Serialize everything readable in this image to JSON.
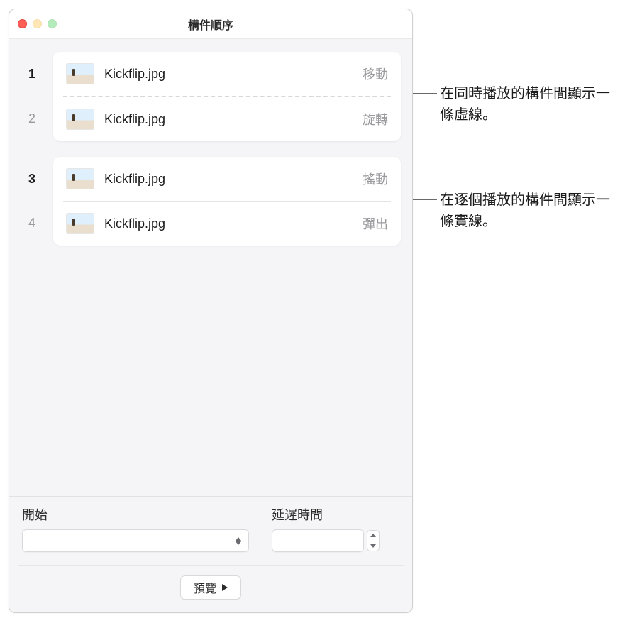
{
  "window": {
    "title": "構件順序"
  },
  "groups": [
    {
      "items": [
        {
          "number": "1",
          "dim": false,
          "filename": "Kickflip.jpg",
          "effect": "移動"
        },
        {
          "number": "2",
          "dim": true,
          "filename": "Kickflip.jpg",
          "effect": "旋轉"
        }
      ],
      "sep": "dashed"
    },
    {
      "items": [
        {
          "number": "3",
          "dim": false,
          "filename": "Kickflip.jpg",
          "effect": "搖動"
        },
        {
          "number": "4",
          "dim": true,
          "filename": "Kickflip.jpg",
          "effect": "彈出"
        }
      ],
      "sep": "solid"
    }
  ],
  "footer": {
    "start_label": "開始",
    "delay_label": "延遲時間",
    "preview_label": "預覽"
  },
  "callouts": {
    "dashed": "在同時播放的構件間顯示一條虛線。",
    "solid": "在逐個播放的構件間顯示一條實線。"
  }
}
